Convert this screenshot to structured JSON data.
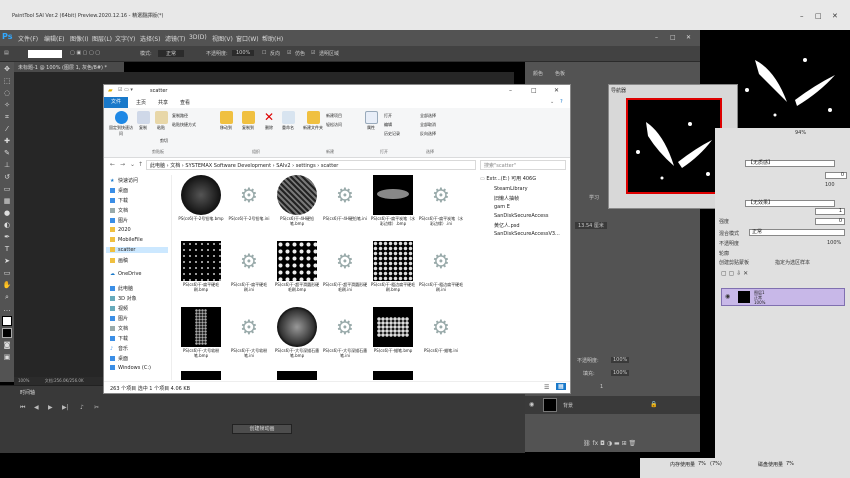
{
  "sai": {
    "title": "PaintTool SAI Ver.2 (64bit) Preview.2020.12.16 - 精選翻譯版(*)",
    "navigator_title": "导航器",
    "statusbar": {
      "memory_label": "内存使用量",
      "memory_value": "7%",
      "memory_extra": "(7%)",
      "disk_label": "磁盘使用量",
      "disk_value": "7%"
    },
    "props": {
      "zoom_pct": "94%",
      "none1": "【无质感】",
      "none2": "【无效果】",
      "blend_mode_label": "混合模式",
      "blend_mode_value": "正常",
      "opacity_label": "不透明度",
      "opacity_value": "100%",
      "edge_label": "轮廓",
      "clip_label": "创建剪贴蒙板",
      "ref_label": "指定为选区样本",
      "intensity_label": "强度",
      "val_0": "0",
      "val_100": "100",
      "val_1": "1",
      "layer_name": "图层1",
      "layer_mode": "正常",
      "layer_opacity": "100%"
    }
  },
  "ps": {
    "logo": "Ps",
    "menu": [
      "文件(F)",
      "编辑(E)",
      "图像(I)",
      "图层(L)",
      "文字(Y)",
      "选择(S)",
      "滤镜(T)",
      "3D(D)",
      "视图(V)",
      "窗口(W)",
      "帮助(H)"
    ],
    "options": {
      "mode_label": "模式:",
      "mode_value": "正常",
      "opacity_label": "不透明度:",
      "opacity_value": "100%",
      "reverse": "反向",
      "dither": "仿色",
      "transparency": "透明区域"
    },
    "doc_tab": "未标题-1 @ 100% (图层 1, 灰色/8#) *",
    "status_zoom": "100%",
    "status_doc": "文档:256.0K/256.0K",
    "timeline_label": "时间轴",
    "create_button": "创建帧动画",
    "panels": {
      "color": "颜色",
      "swatches": "色板",
      "learn": "学习",
      "adjust": "调整",
      "layers": "图层",
      "opacity_label": "不透明度:",
      "opacity_value": "100%",
      "fill_label": "填充:",
      "fill_value": "100%",
      "background_layer": "背景",
      "measure": "13.54 厘米",
      "num": "1"
    }
  },
  "explorer": {
    "title": "scatter",
    "tabs": [
      "文件",
      "主页",
      "共享",
      "查看"
    ],
    "ribbon": {
      "pin": "固定到快速访问",
      "copy": "复制",
      "paste": "粘贴",
      "copy_path": "复制路径",
      "paste_shortcut": "粘贴快捷方式",
      "cut": "剪切",
      "move_to": "移动到",
      "copy_to": "复制到",
      "delete": "删除",
      "rename": "重命名",
      "new_folder": "新建文件夹",
      "new_item": "新建项目",
      "easy_access": "轻松访问",
      "properties": "属性",
      "open": "打开",
      "edit": "编辑",
      "history": "历史记录",
      "select_all": "全部选择",
      "select_none": "全部取消",
      "invert": "反向选择",
      "g_clipboard": "剪贴板",
      "g_organize": "组织",
      "g_new": "新建",
      "g_open": "打开",
      "g_select": "选择"
    },
    "path": [
      "此电脑",
      "文档",
      "SYSTEMAX Software Development",
      "SAIv2",
      "settings",
      "scatter"
    ],
    "search_placeholder": "搜索\"scatter\"",
    "nav": [
      "快速访问",
      "桌面",
      "下载",
      "文档",
      "图片",
      "2020",
      "MobileFile",
      "scatter",
      "画稿",
      "OneDrive",
      "此电脑",
      "3D 对象",
      "视频",
      "图片",
      "文档",
      "下载",
      "音乐",
      "桌面",
      "Windows (C:)"
    ],
    "files": [
      "PS(cs6)干-2号铅笔.bmp",
      "PS(cs6)干-2号铅笔.ini",
      "PS(cs6)干-4H硬铅笔.bmp",
      "PS(cs6)干-4H硬铅笔.ini",
      "PS(cs6)干-扁平炭笔（水彩边缘）.bmp",
      "PS(cs6)干-扁平炭笔（水彩边缘）.ini",
      "PS(cs6)干-扁平硬毛刷.bmp",
      "PS(cs6)干-扁平硬毛刷.ini",
      "PS(cs6)干-超平滑圆形硬毛刷.bmp",
      "PS(cs6)干-超平滑圆形硬毛刷.ini",
      "PS(cs6)干-粗边扁平硬毛刷.bmp",
      "PS(cs6)干-粗边扁平硬毛刷.ini",
      "PS(cs6)干-大号软粉笔.bmp",
      "PS(cs6)干-大号软粉笔.ini",
      "PS(cs6)干-大号深描石墨笔.bmp",
      "PS(cs6)干-大号深描石墨笔.ini",
      "PS(cs6)干-蜡笔.bmp",
      "PS(cs6)干-蜡笔.ini"
    ],
    "right_pane": {
      "header": "Extr...(E:) 可用 406G",
      "items": [
        "SteamLibrary",
        "旧懒人抽帧",
        "gam E",
        "SanDiskSecureAccess",
        "黄亿人.psd",
        "SanDiskSecureAccessV3..."
      ]
    },
    "status": "263 个项目    选中 1 个项目  4.06 KB"
  }
}
